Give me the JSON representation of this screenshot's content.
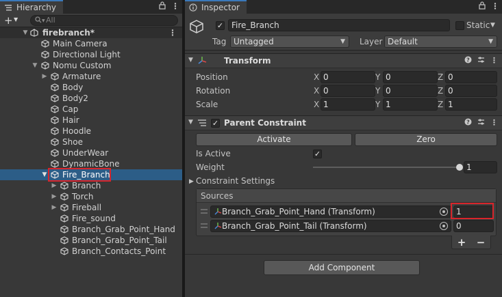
{
  "hierarchy": {
    "tab_label": "Hierarchy",
    "search_placeholder": "All",
    "scene_name": "firebranch*",
    "items": [
      {
        "label": "Main Camera"
      },
      {
        "label": "Directional Light"
      },
      {
        "label": "Nomu Custom"
      },
      {
        "label": "Armature"
      },
      {
        "label": "Body"
      },
      {
        "label": "Body2"
      },
      {
        "label": "Cap"
      },
      {
        "label": "Hair"
      },
      {
        "label": "Hoodle"
      },
      {
        "label": "Shoe"
      },
      {
        "label": "UnderWear"
      },
      {
        "label": "DynamicBone"
      },
      {
        "label": "Fire_Branch"
      },
      {
        "label": "Branch"
      },
      {
        "label": "Torch"
      },
      {
        "label": "Fireball"
      },
      {
        "label": "Fire_sound"
      },
      {
        "label": "Branch_Grab_Point_Hand"
      },
      {
        "label": "Branch_Grab_Point_Tail"
      },
      {
        "label": "Branch_Contacts_Point"
      }
    ]
  },
  "inspector": {
    "tab_label": "Inspector",
    "object_name": "Fire_Branch",
    "static_label": "Static",
    "tag_label": "Tag",
    "tag_value": "Untagged",
    "layer_label": "Layer",
    "layer_value": "Default",
    "transform": {
      "title": "Transform",
      "rows": [
        {
          "label": "Position",
          "x": "0",
          "y": "0",
          "z": "0"
        },
        {
          "label": "Rotation",
          "x": "0",
          "y": "0",
          "z": "0"
        },
        {
          "label": "Scale",
          "x": "1",
          "y": "1",
          "z": "1"
        }
      ],
      "axis_x": "X",
      "axis_y": "Y",
      "axis_z": "Z"
    },
    "parent_constraint": {
      "title": "Parent Constraint",
      "activate_label": "Activate",
      "zero_label": "Zero",
      "is_active_label": "Is Active",
      "weight_label": "Weight",
      "weight_value": "1",
      "weight_fraction": 1,
      "settings_label": "Constraint Settings",
      "sources_label": "Sources",
      "sources": [
        {
          "name": "Branch_Grab_Point_Hand (Transform)",
          "weight": "1"
        },
        {
          "name": "Branch_Grab_Point_Tail (Transform)",
          "weight": "0"
        }
      ],
      "plus_label": "+",
      "minus_label": "−"
    },
    "add_component_label": "Add Component"
  },
  "colors": {
    "selection": "#2c5d87",
    "highlight_box": "#d8252b",
    "accent_tab": "#3a79bb"
  }
}
